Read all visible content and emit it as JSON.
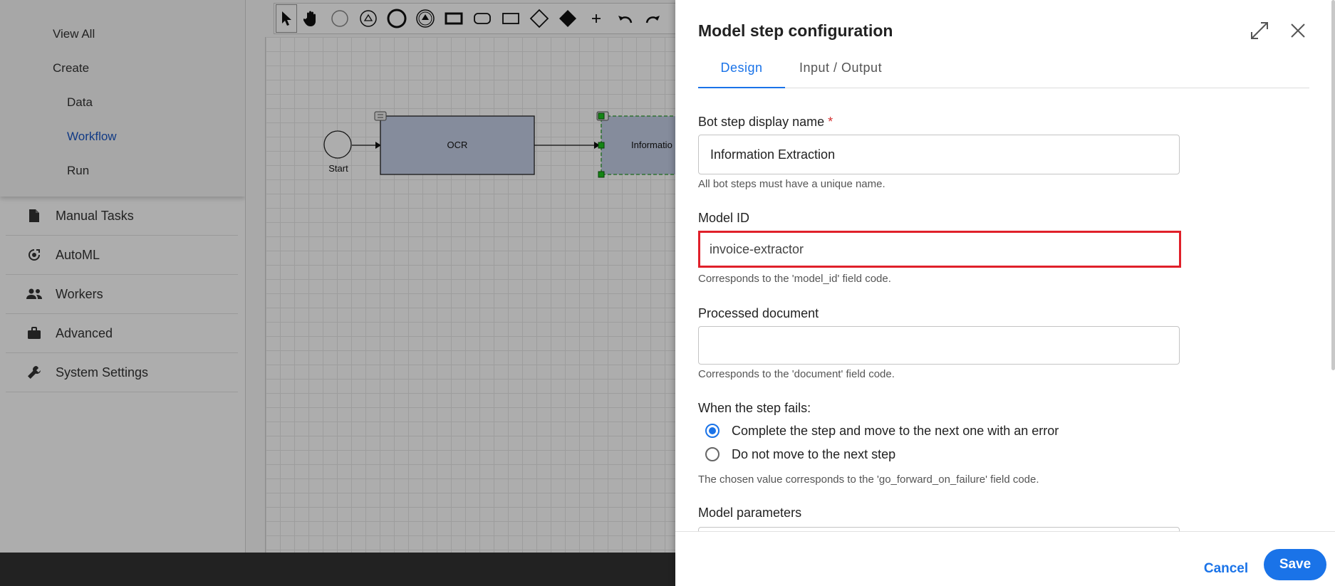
{
  "sidebar": {
    "submenu": {
      "view_all": "View All",
      "create": "Create",
      "data": "Data",
      "workflow": "Workflow",
      "run": "Run"
    },
    "items": [
      {
        "label": "Manual Tasks",
        "icon": "document-icon"
      },
      {
        "label": "AutoML",
        "icon": "automl-icon"
      },
      {
        "label": "Workers",
        "icon": "people-icon"
      },
      {
        "label": "Advanced",
        "icon": "briefcase-icon"
      },
      {
        "label": "System Settings",
        "icon": "wrench-icon"
      }
    ]
  },
  "canvas": {
    "toolbar_tools": [
      "pointer-icon",
      "hand-icon",
      "start-event-icon",
      "intermediate-event-icon",
      "end-event-icon",
      "event-icon",
      "task-icon",
      "subprocess-icon",
      "frame-icon",
      "gateway-icon",
      "filled-gateway-icon",
      "plus-icon",
      "undo-icon",
      "redo-icon"
    ],
    "nodes": {
      "start": "Start",
      "ocr": "OCR",
      "info": "Informatio"
    }
  },
  "panel": {
    "title": "Model step configuration",
    "tabs": [
      "Design",
      "Input / Output"
    ],
    "active_tab": "Design",
    "fields": {
      "display_name": {
        "label": "Bot step display name",
        "required_mark": "*",
        "value": "Information Extraction",
        "help": "All bot steps must have a unique name."
      },
      "model_id": {
        "label": "Model ID",
        "value": "invoice-extractor",
        "help": "Corresponds to the 'model_id' field code."
      },
      "processed_document": {
        "label": "Processed document",
        "value": "",
        "help": "Corresponds to the 'document' field code."
      },
      "failure": {
        "label": "When the step fails:",
        "options": [
          "Complete the step and move to the next one with an error",
          "Do not move to the next step"
        ],
        "selected": "Complete the step and move to the next one with an error",
        "help": "The chosen value corresponds to the 'go_forward_on_failure' field code."
      },
      "model_parameters": {
        "label": "Model parameters"
      }
    },
    "footer": {
      "cancel": "Cancel",
      "save": "Save"
    }
  },
  "colors": {
    "accent": "#1a73e8",
    "highlight_border": "#e0202a",
    "workflow_link": "#1a56c4",
    "node_fill": "#c5cfe6"
  }
}
